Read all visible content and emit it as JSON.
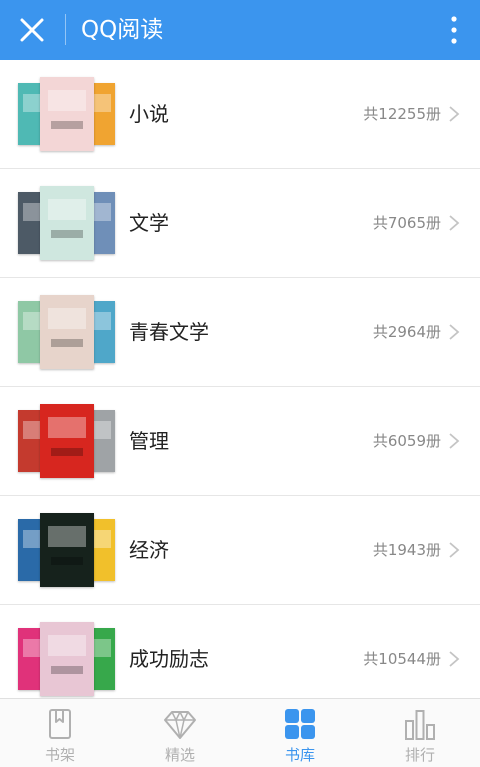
{
  "header": {
    "title": "QQ阅读",
    "background": "#3b95ee"
  },
  "categories": [
    {
      "title": "小说",
      "count": "共12255册",
      "covers": [
        "#4fb9b4",
        "#f3d6d6",
        "#f0a431"
      ]
    },
    {
      "title": "文学",
      "count": "共7065册",
      "covers": [
        "#4d5a66",
        "#cfe7df",
        "#6f8fb8"
      ]
    },
    {
      "title": "青春文学",
      "count": "共2964册",
      "covers": [
        "#8fc8a5",
        "#e7d4cb",
        "#4fa7c9"
      ]
    },
    {
      "title": "管理",
      "count": "共6059册",
      "covers": [
        "#c43a2e",
        "#d7261f",
        "#9fa3a6"
      ]
    },
    {
      "title": "经济",
      "count": "共1943册",
      "covers": [
        "#2a6aa8",
        "#16221c",
        "#f1c02b"
      ]
    },
    {
      "title": "成功励志",
      "count": "共10544册",
      "covers": [
        "#e0327a",
        "#e8c6d4",
        "#37a84b"
      ]
    }
  ],
  "tabs": [
    {
      "label": "书架",
      "icon": "bookmark-icon",
      "active": false
    },
    {
      "label": "精选",
      "icon": "diamond-icon",
      "active": false
    },
    {
      "label": "书库",
      "icon": "grid-icon",
      "active": true
    },
    {
      "label": "排行",
      "icon": "bar-chart-icon",
      "active": false
    }
  ],
  "colors": {
    "accent": "#3b95ee",
    "inactive": "#b0b0b0",
    "text": "#222222",
    "count": "#888888"
  }
}
